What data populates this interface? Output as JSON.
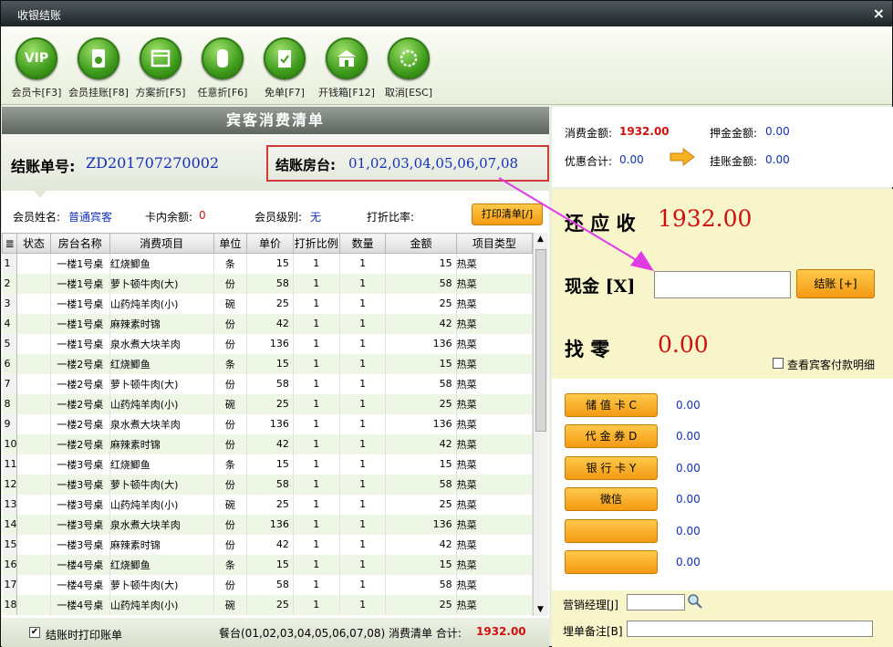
{
  "window": {
    "title": "收银结账",
    "close": "×"
  },
  "toolbar": [
    {
      "icon": "vip-card-icon",
      "glyph": "VIP",
      "label": "会员卡[F3]"
    },
    {
      "icon": "member-credit-icon",
      "glyph": "",
      "label": "会员挂账[F8]"
    },
    {
      "icon": "plan-discount-icon",
      "glyph": "",
      "label": "方案折[F5]"
    },
    {
      "icon": "any-discount-icon",
      "glyph": "",
      "label": "任意折[F6]"
    },
    {
      "icon": "free-order-icon",
      "glyph": "",
      "label": "免单[F7]"
    },
    {
      "icon": "cash-drawer-icon",
      "glyph": "",
      "label": "开钱箱[F12]"
    },
    {
      "icon": "cancel-icon",
      "glyph": "",
      "label": "取消[ESC]"
    }
  ],
  "left": {
    "header": "宾客消费清单",
    "bill_label": "结账单号:",
    "bill_no": "ZD201707270002",
    "room_label": "结账房台:",
    "room_value": "01,02,03,04,05,06,07,08",
    "member_name_label": "会员姓名:",
    "member_name": "普通宾客",
    "card_balance_label": "卡内余额:",
    "card_balance": "0",
    "member_level_label": "会员级别:",
    "member_level": "无",
    "discount_rate_label": "打折比率:",
    "print_btn": "打印清单[/]",
    "columns": [
      "状态",
      "房台名称",
      "消费项目",
      "单位",
      "单价",
      "打折比例",
      "数量",
      "金额",
      "项目类型"
    ],
    "rows": [
      [
        "1",
        "",
        "一楼1号桌",
        "红烧鲫鱼",
        "条",
        "15",
        "1",
        "1",
        "15",
        "热菜"
      ],
      [
        "2",
        "",
        "一楼1号桌",
        "萝卜顿牛肉(大)",
        "份",
        "58",
        "1",
        "1",
        "58",
        "热菜"
      ],
      [
        "3",
        "",
        "一楼1号桌",
        "山药炖羊肉(小)",
        "碗",
        "25",
        "1",
        "1",
        "25",
        "热菜"
      ],
      [
        "4",
        "",
        "一楼1号桌",
        "麻辣素时锦",
        "份",
        "42",
        "1",
        "1",
        "42",
        "热菜"
      ],
      [
        "5",
        "",
        "一楼1号桌",
        "泉水煮大块羊肉",
        "份",
        "136",
        "1",
        "1",
        "136",
        "热菜"
      ],
      [
        "6",
        "",
        "一楼2号桌",
        "红烧鲫鱼",
        "条",
        "15",
        "1",
        "1",
        "15",
        "热菜"
      ],
      [
        "7",
        "",
        "一楼2号桌",
        "萝卜顿牛肉(大)",
        "份",
        "58",
        "1",
        "1",
        "58",
        "热菜"
      ],
      [
        "8",
        "",
        "一楼2号桌",
        "山药炖羊肉(小)",
        "碗",
        "25",
        "1",
        "1",
        "25",
        "热菜"
      ],
      [
        "9",
        "",
        "一楼2号桌",
        "泉水煮大块羊肉",
        "份",
        "136",
        "1",
        "1",
        "136",
        "热菜"
      ],
      [
        "10",
        "",
        "一楼2号桌",
        "麻辣素时锦",
        "份",
        "42",
        "1",
        "1",
        "42",
        "热菜"
      ],
      [
        "11",
        "",
        "一楼3号桌",
        "红烧鲫鱼",
        "条",
        "15",
        "1",
        "1",
        "15",
        "热菜"
      ],
      [
        "12",
        "",
        "一楼3号桌",
        "萝卜顿牛肉(大)",
        "份",
        "58",
        "1",
        "1",
        "58",
        "热菜"
      ],
      [
        "13",
        "",
        "一楼3号桌",
        "山药炖羊肉(小)",
        "碗",
        "25",
        "1",
        "1",
        "25",
        "热菜"
      ],
      [
        "14",
        "",
        "一楼3号桌",
        "泉水煮大块羊肉",
        "份",
        "136",
        "1",
        "1",
        "136",
        "热菜"
      ],
      [
        "15",
        "",
        "一楼3号桌",
        "麻辣素时锦",
        "份",
        "42",
        "1",
        "1",
        "42",
        "热菜"
      ],
      [
        "16",
        "",
        "一楼4号桌",
        "红烧鲫鱼",
        "条",
        "15",
        "1",
        "1",
        "15",
        "热菜"
      ],
      [
        "17",
        "",
        "一楼4号桌",
        "萝卜顿牛肉(大)",
        "份",
        "58",
        "1",
        "1",
        "58",
        "热菜"
      ],
      [
        "18",
        "",
        "一楼4号桌",
        "山药炖羊肉(小)",
        "碗",
        "25",
        "1",
        "1",
        "25",
        "热菜"
      ]
    ],
    "footer": {
      "print_on_settle": "结账时打印账单",
      "summary": "餐台(01,02,03,04,05,06,07,08) 消费清单 合计:",
      "total": "1932.00"
    }
  },
  "right": {
    "consume_label": "消费金额:",
    "consume_value": "1932.00",
    "deposit_label": "押金金额:",
    "deposit_value": "0.00",
    "discount_label": "优惠合计:",
    "discount_value": "0.00",
    "credit_label": "挂账金额:",
    "credit_value": "0.00",
    "due_label": "还 应 收",
    "due_value": "1932.00",
    "cash_label": "现金 [X]",
    "cash_value": "",
    "settle_btn": "结账 [+]",
    "change_label": "找    零",
    "change_value": "0.00",
    "detail_check": "查看宾客付款明细",
    "payments": [
      {
        "label": "储 值 卡 C",
        "value": "0.00"
      },
      {
        "label": "代 金 券 D",
        "value": "0.00"
      },
      {
        "label": "银 行 卡 Y",
        "value": "0.00"
      },
      {
        "label": "微信",
        "value": "0.00"
      },
      {
        "label": "",
        "value": "0.00"
      },
      {
        "label": "",
        "value": "0.00"
      }
    ],
    "manager_label": "营销经理[J]",
    "remark_label": "埋单备注[B]"
  },
  "colors": {
    "accent_red": "#d01010",
    "value_blue": "#1530b8",
    "button_orange": "#f39a13",
    "highlight_box": "#d23a3a",
    "arrow": "#e03ce6"
  }
}
